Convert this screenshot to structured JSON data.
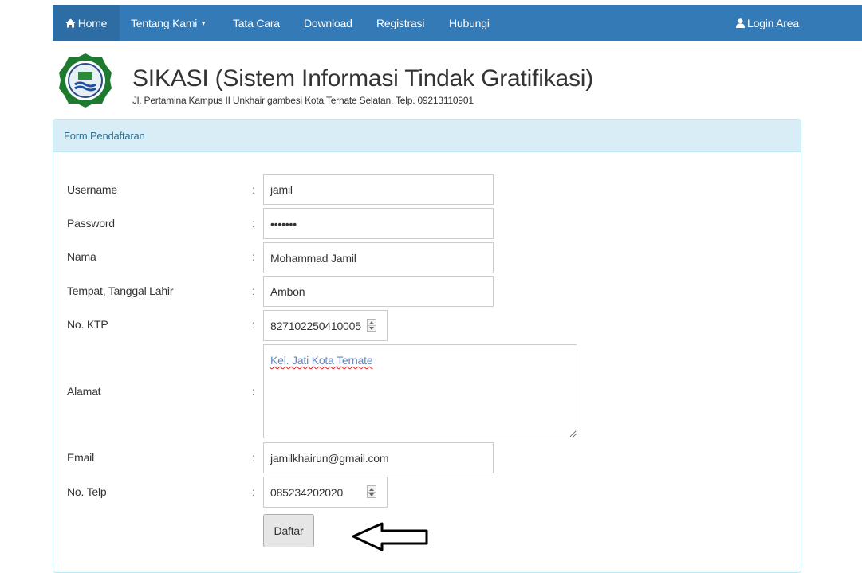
{
  "nav": {
    "home": "Home",
    "tentang": "Tentang Kami",
    "caret": "▾",
    "tata_cara": "Tata Cara",
    "download": "Download",
    "registrasi": "Registrasi",
    "hubungi": "Hubungi",
    "login": "Login Area",
    "bg_color": "#337ab7",
    "active_color": "#2e6da4"
  },
  "header": {
    "title": "SIKASI (Sistem Informasi Tindak Gratifikasi)",
    "address": "Jl. Pertamina Kampus II Unkhair gambesi Kota Ternate Selatan. Telp. 09213110901"
  },
  "form": {
    "heading": "Form Pendaftaran",
    "colon": ":",
    "fields": {
      "username": {
        "label": "Username",
        "value": "jamil"
      },
      "password": {
        "label": "Password",
        "value": "jamil12"
      },
      "nama": {
        "label": "Nama",
        "value": "Mohammad Jamil"
      },
      "ttl": {
        "label": "Tempat, Tanggal Lahir",
        "value": "Ambon"
      },
      "ktp": {
        "label": "No. KTP",
        "value": "827102250410005"
      },
      "alamat": {
        "label": "Alamat",
        "value": "Kel. Jati Kota Ternate"
      },
      "email": {
        "label": "Email",
        "value": "jamilkhairun@gmail.com"
      },
      "telp": {
        "label": "No. Telp",
        "value": "085234202020"
      }
    },
    "submit_label": "Daftar"
  },
  "icons": {
    "home": "home-icon",
    "user": "user-icon",
    "logo": "university-logo",
    "annotation": "arrow-left-outline"
  }
}
